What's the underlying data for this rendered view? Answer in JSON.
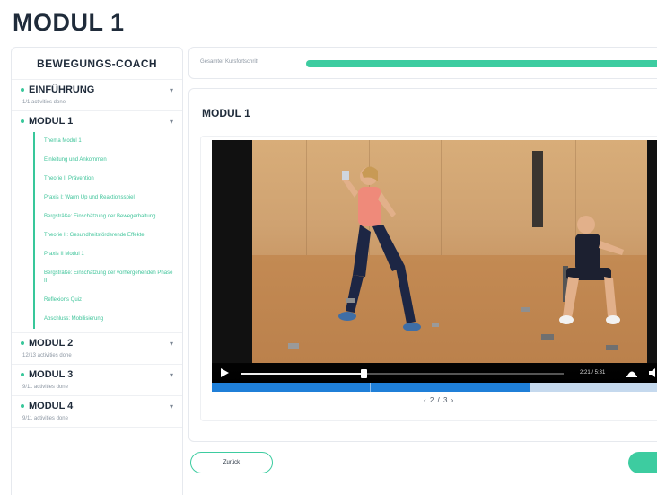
{
  "page": {
    "title": "MODUL 1"
  },
  "sidebar": {
    "header": "BEWEGUNGS-COACH",
    "modules": [
      {
        "title": "EINFÜHRUNG",
        "subtitle": "1/1 activities done",
        "expanded": false
      },
      {
        "title": "MODUL 1",
        "subtitle": "",
        "expanded": true,
        "lessons": [
          "Thema Modul 1",
          "Einleitung und Ankommen",
          "Theorie I: Prävention",
          "Praxis I: Warm Up und Reaktionsspiel",
          "Bergsträße: Einschätzung der Bewegerhaltung",
          "Theorie II: Gesundheitsförderende Effekte",
          "Praxis II Modul 1",
          "Bergsträße: Einschätzung der vorhergehenden Phase II",
          "Reflexions Quiz",
          "Abschluss: Mobilisierung"
        ]
      },
      {
        "title": "MODUL 2",
        "subtitle": "12/13 activities done",
        "expanded": false
      },
      {
        "title": "MODUL 3",
        "subtitle": "9/11 activities done",
        "expanded": false
      },
      {
        "title": "MODUL 4",
        "subtitle": "9/11 activities done",
        "expanded": false
      }
    ]
  },
  "progress": {
    "label": "Gesamter Kursfortschritt",
    "value": 0.97
  },
  "content": {
    "title": "MODUL 1"
  },
  "video": {
    "time": "2:21 / 5:31",
    "played_fraction": 0.38,
    "buffered_fraction": 0.71,
    "icons": {
      "play": "play-icon",
      "hat": "hat-icon",
      "volume": "volume-icon"
    }
  },
  "pager": {
    "text": "‹ 2 / 3 ›"
  },
  "buttons": {
    "back": "Zurück",
    "next": ""
  },
  "colors": {
    "accent": "#3dcca0",
    "title": "#1f2b3a",
    "video_progress": "#1f7fd8"
  }
}
